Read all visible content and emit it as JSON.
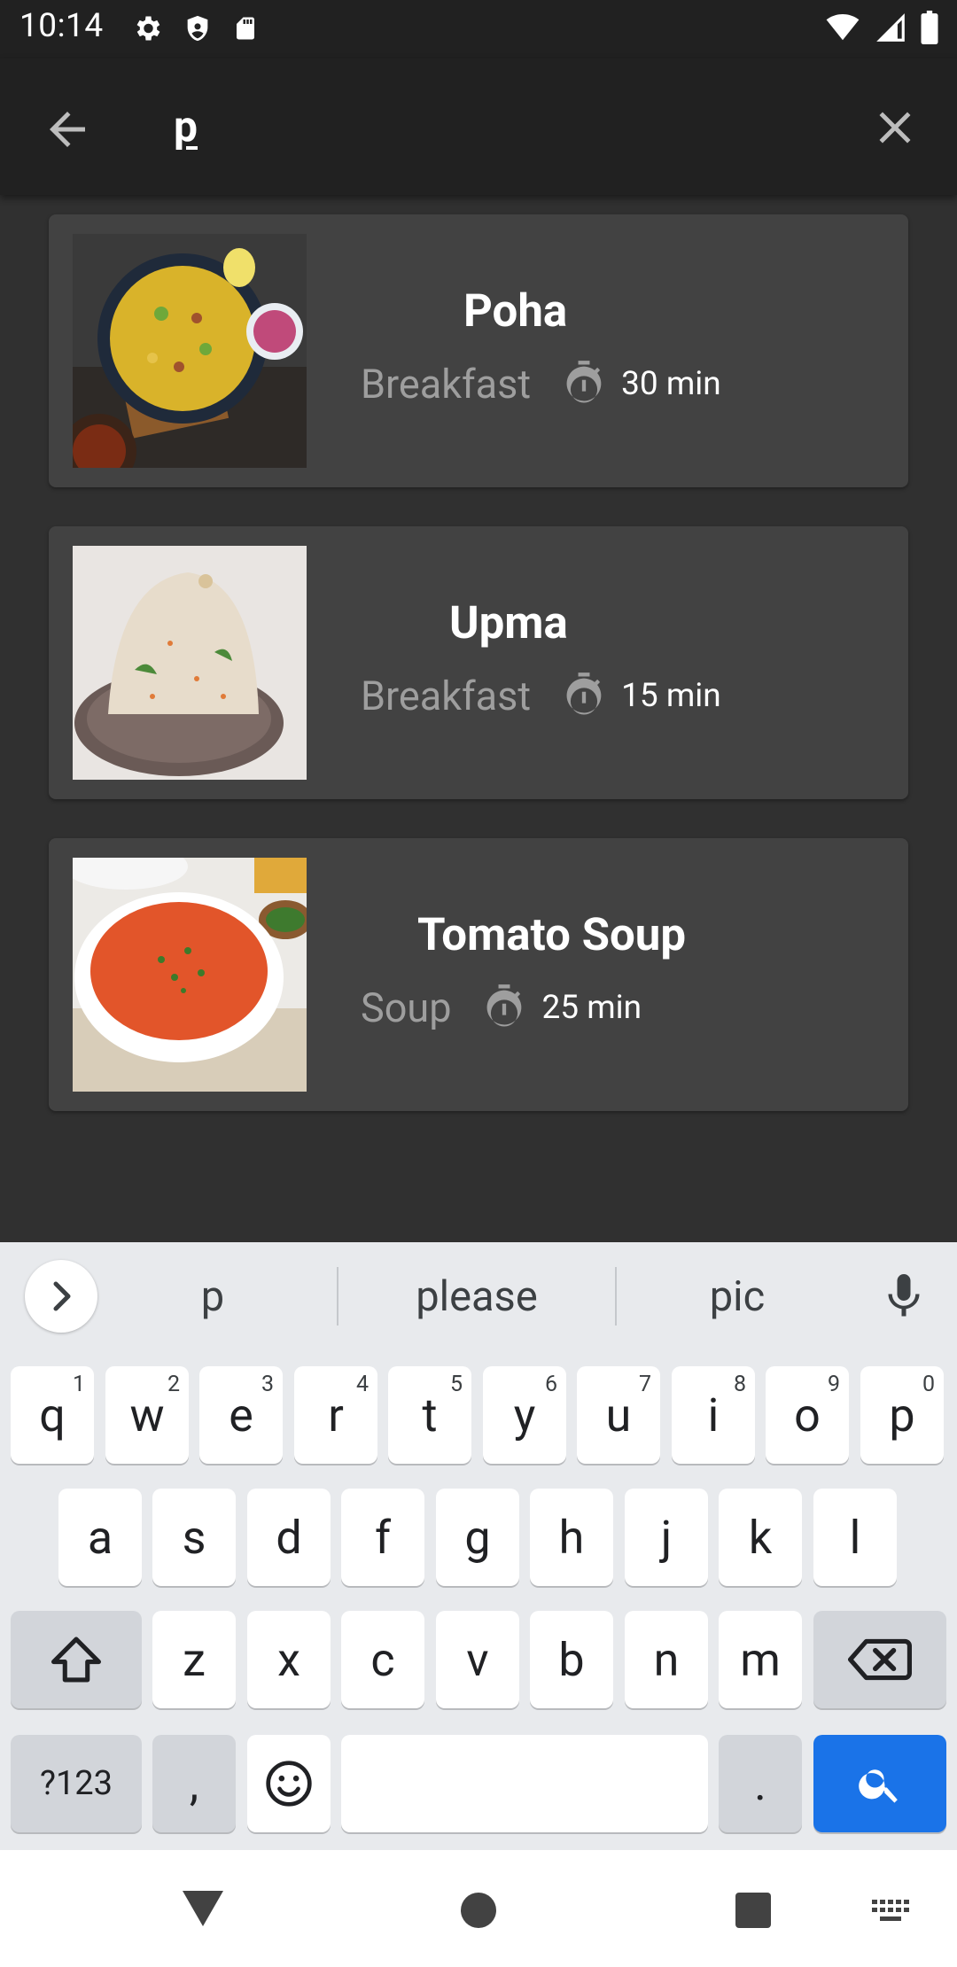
{
  "status_bar": {
    "time": "10:14",
    "icons_left": [
      "settings-icon",
      "shield-icon",
      "sd-card-icon"
    ],
    "icons_right": [
      "wifi-icon",
      "signal-icon",
      "battery-icon"
    ]
  },
  "search": {
    "query": "p",
    "back_icon": "arrow-back-icon",
    "clear_icon": "close-icon"
  },
  "results": [
    {
      "title": "Poha",
      "category": "Breakfast",
      "duration": "30 min"
    },
    {
      "title": "Upma",
      "category": "Breakfast",
      "duration": "15 min"
    },
    {
      "title": "Tomato Soup",
      "category": "Soup",
      "duration": "25 min"
    }
  ],
  "keyboard": {
    "suggestions": [
      "p",
      "please",
      "pic"
    ],
    "row1": [
      {
        "k": "q",
        "n": "1"
      },
      {
        "k": "w",
        "n": "2"
      },
      {
        "k": "e",
        "n": "3"
      },
      {
        "k": "r",
        "n": "4"
      },
      {
        "k": "t",
        "n": "5"
      },
      {
        "k": "y",
        "n": "6"
      },
      {
        "k": "u",
        "n": "7"
      },
      {
        "k": "i",
        "n": "8"
      },
      {
        "k": "o",
        "n": "9"
      },
      {
        "k": "p",
        "n": "0"
      }
    ],
    "row2": [
      "a",
      "s",
      "d",
      "f",
      "g",
      "h",
      "j",
      "k",
      "l"
    ],
    "row3": [
      "z",
      "x",
      "c",
      "v",
      "b",
      "n",
      "m"
    ],
    "symbols_label": "?123",
    "comma_label": ",",
    "period_label": "."
  },
  "colors": {
    "background": "#303030",
    "card": "#424242",
    "appbar": "#212121",
    "keyboard_bg": "#e8eaed",
    "search_key": "#1a73e8"
  }
}
